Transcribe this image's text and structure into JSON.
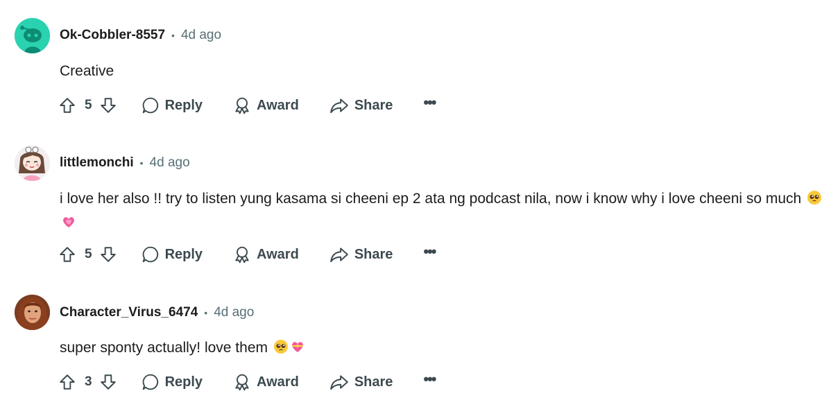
{
  "comments": [
    {
      "username": "Ok-Cobbler-8557",
      "separator": "•",
      "time": "4d ago",
      "text": "Creative",
      "score": "5",
      "reply_label": "Reply",
      "award_label": "Award",
      "share_label": "Share",
      "more_label": "•••",
      "avatar_icon": "snoo-default-avatar-icon",
      "avatar_color": "#2ad2b0"
    },
    {
      "username": "littlemonchi",
      "separator": "•",
      "time": "4d ago",
      "text": "i love her also !! try to listen yung kasama si cheeni ep 2 ata ng podcast nila, now i know why i love cheeni so much",
      "emojis": [
        "pleading-face-emoji",
        "growing-heart-emoji"
      ],
      "score": "5",
      "reply_label": "Reply",
      "award_label": "Award",
      "share_label": "Share",
      "more_label": "•••",
      "avatar_icon": "drawn-girl-avatar-icon",
      "avatar_color": "#f3eef0"
    },
    {
      "username": "Character_Virus_6474",
      "separator": "•",
      "time": "4d ago",
      "text": "super sponty actually! love them",
      "emojis": [
        "pleading-face-emoji",
        "heart-with-ribbon-emoji"
      ],
      "score": "3",
      "reply_label": "Reply",
      "award_label": "Award",
      "share_label": "Share",
      "more_label": "•••",
      "avatar_icon": "photo-avatar-icon",
      "avatar_color": "#7a3d22"
    }
  ],
  "colors": {
    "text": "#1c1c1c",
    "meta": "#576f76",
    "action": "#3c4a4f"
  }
}
